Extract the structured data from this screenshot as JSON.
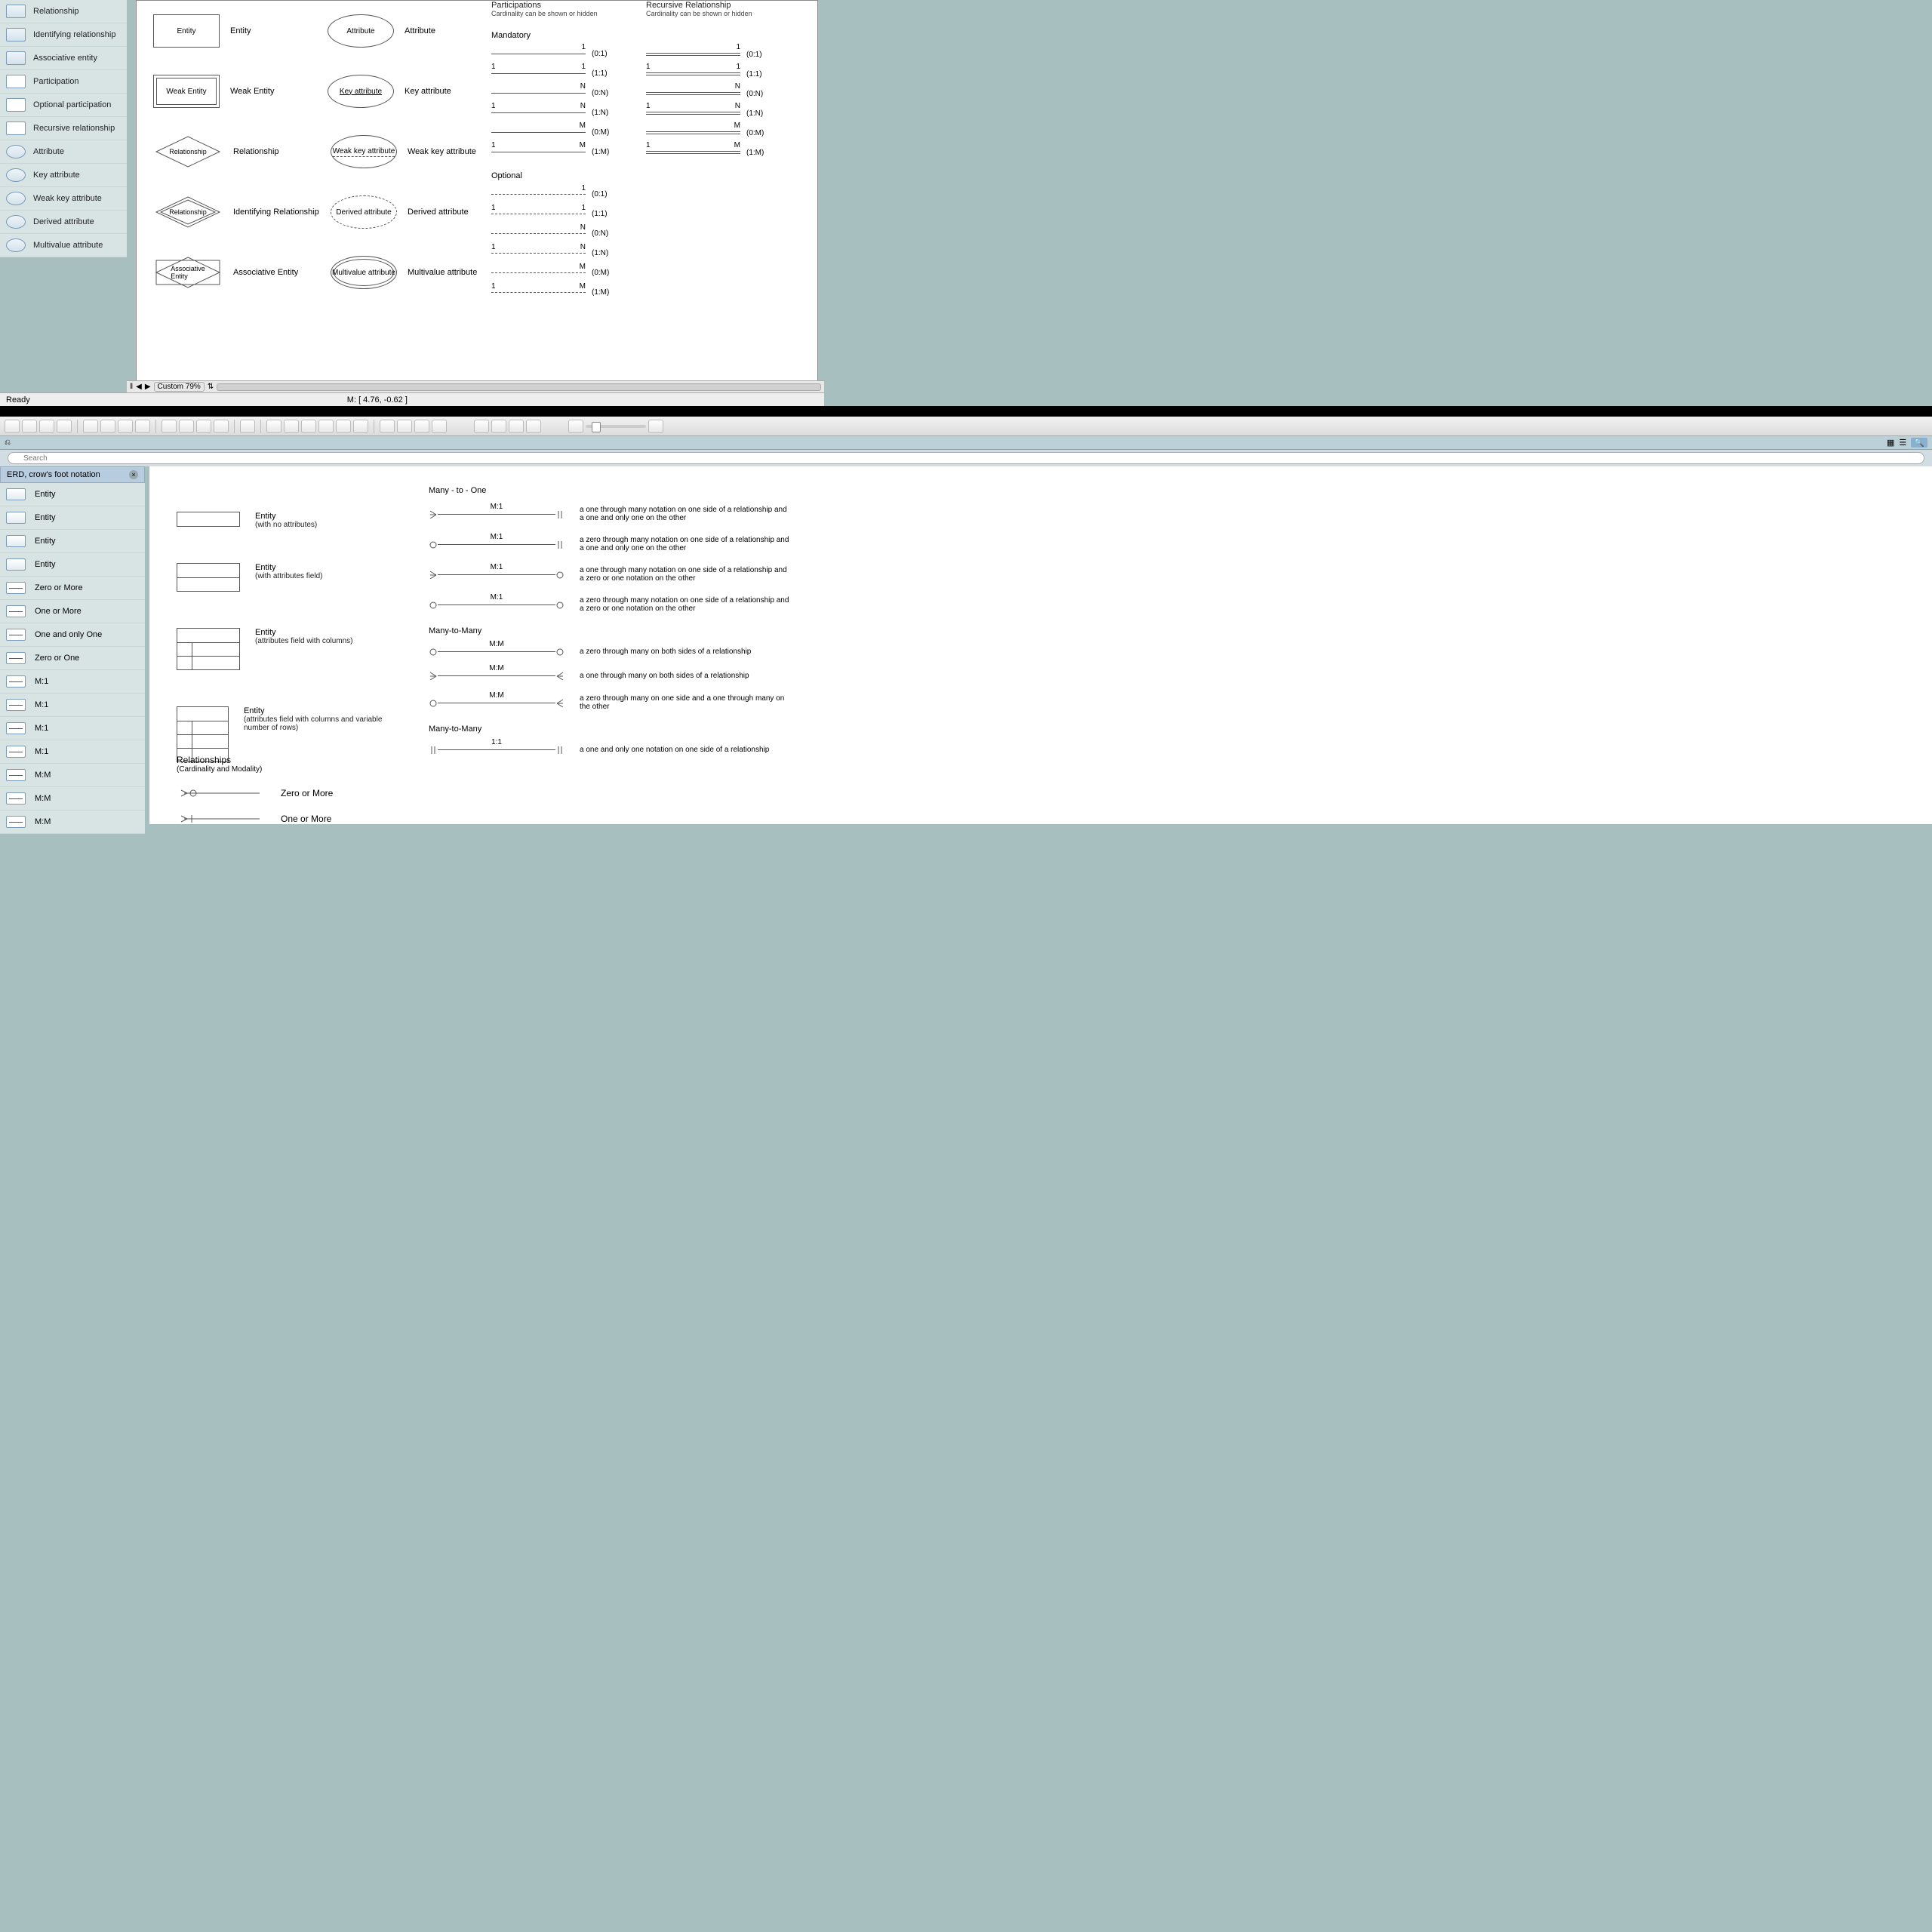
{
  "sidebar1": {
    "items": [
      {
        "label": "Relationship",
        "shape": "diamond"
      },
      {
        "label": "Identifying relationship",
        "shape": "diamond"
      },
      {
        "label": "Associative entity",
        "shape": "diamond"
      },
      {
        "label": "Participation",
        "shape": "rect"
      },
      {
        "label": "Optional participation",
        "shape": "rect"
      },
      {
        "label": "Recursive relationship",
        "shape": "rect"
      },
      {
        "label": "Attribute",
        "shape": "ellipse"
      },
      {
        "label": "Key attribute",
        "shape": "ellipse"
      },
      {
        "label": "Weak key attribute",
        "shape": "ellipse"
      },
      {
        "label": "Derived attribute",
        "shape": "ellipse"
      },
      {
        "label": "Multivalue attribute",
        "shape": "ellipse"
      }
    ]
  },
  "canvas1": {
    "shapes": [
      {
        "type": "rect",
        "variant": "single",
        "text": "Entity",
        "label": "Entity"
      },
      {
        "type": "rect",
        "variant": "double",
        "text": "Weak Entity",
        "label": "Weak Entity"
      },
      {
        "type": "diamond",
        "variant": "single",
        "text": "Relationship",
        "label": "Relationship"
      },
      {
        "type": "diamond",
        "variant": "double",
        "text": "Relationship",
        "label": "Identifying Relationship"
      },
      {
        "type": "diamond",
        "variant": "assoc",
        "text": "Associative Entity",
        "label": "Associative Entity"
      }
    ],
    "attrs": [
      {
        "variant": "plain",
        "text": "Attribute",
        "label": "Attribute"
      },
      {
        "variant": "underline",
        "text": "Key attribute",
        "label": "Key attribute"
      },
      {
        "variant": "dotted-under",
        "text": "Weak key attribute",
        "label": "Weak key attribute"
      },
      {
        "variant": "dashed",
        "text": "Derived attribute",
        "label": "Derived attribute"
      },
      {
        "variant": "double",
        "text": "Multivalue attribute",
        "label": "Multivalue attribute"
      }
    ],
    "participations_title": "Participations",
    "recursive_title": "Recursive Relationship",
    "card_sub": "Cardinality can be shown or hidden",
    "mandatory_label": "Mandatory",
    "optional_label": "Optional",
    "mandatory": [
      {
        "left": "",
        "right": "1",
        "ratio": "(0:1)"
      },
      {
        "left": "1",
        "right": "1",
        "ratio": "(1:1)"
      },
      {
        "left": "",
        "right": "N",
        "ratio": "(0:N)"
      },
      {
        "left": "1",
        "right": "N",
        "ratio": "(1:N)"
      },
      {
        "left": "",
        "right": "M",
        "ratio": "(0:M)"
      },
      {
        "left": "1",
        "right": "M",
        "ratio": "(1:M)"
      }
    ],
    "optional": [
      {
        "left": "",
        "right": "1",
        "ratio": "(0:1)"
      },
      {
        "left": "1",
        "right": "1",
        "ratio": "(1:1)"
      },
      {
        "left": "",
        "right": "N",
        "ratio": "(0:N)"
      },
      {
        "left": "1",
        "right": "N",
        "ratio": "(1:N)"
      },
      {
        "left": "",
        "right": "M",
        "ratio": "(0:M)"
      },
      {
        "left": "1",
        "right": "M",
        "ratio": "(1:M)"
      }
    ]
  },
  "footer": {
    "zoom": "Custom 79%",
    "ready": "Ready",
    "coords": "M: [ 4.76, -0.62 ]"
  },
  "search_placeholder": "Search",
  "library2": {
    "title": "ERD, crow's foot notation",
    "items": [
      {
        "label": "Entity",
        "kind": "rect"
      },
      {
        "label": "Entity",
        "kind": "rect"
      },
      {
        "label": "Entity",
        "kind": "rect"
      },
      {
        "label": "Entity",
        "kind": "rect"
      },
      {
        "label": "Zero or More",
        "kind": "conn"
      },
      {
        "label": "One or More",
        "kind": "conn"
      },
      {
        "label": "One and only One",
        "kind": "conn"
      },
      {
        "label": "Zero or One",
        "kind": "conn"
      },
      {
        "label": "M:1",
        "kind": "conn"
      },
      {
        "label": "M:1",
        "kind": "conn"
      },
      {
        "label": "M:1",
        "kind": "conn"
      },
      {
        "label": "M:1",
        "kind": "conn"
      },
      {
        "label": "M:M",
        "kind": "conn"
      },
      {
        "label": "M:M",
        "kind": "conn"
      },
      {
        "label": "M:M",
        "kind": "conn"
      }
    ]
  },
  "canvas2": {
    "entities": [
      {
        "title": "Entity",
        "sub": "(with no attributes)",
        "rows": 1
      },
      {
        "title": "Entity",
        "sub": "(with attributes field)",
        "rows": 2
      },
      {
        "title": "Entity",
        "sub": "(attributes field with columns)",
        "rows": 3
      },
      {
        "title": "Entity",
        "sub": "(attributes field with columns and variable number of rows)",
        "rows": 4
      }
    ],
    "rel_header": "Relationships",
    "rel_sub": "(Cardinality and Modality)",
    "zero_or_more": "Zero or More",
    "one_or_more": "One or More",
    "many_to_one_title": "Many - to - One",
    "many_to_many_title": "Many-to-Many",
    "many_to_many_title2": "Many-to-Many",
    "m1": [
      {
        "lbl": "M:1",
        "desc": "a one through many notation on one side of a relationship and a one and only one on the other"
      },
      {
        "lbl": "M:1",
        "desc": "a zero through many notation on one side of a relationship and a one and only one on the other"
      },
      {
        "lbl": "M:1",
        "desc": "a one through many notation on one side of a relationship and a zero or one notation on the other"
      },
      {
        "lbl": "M:1",
        "desc": "a zero through many notation on one side of a relationship and a zero or one notation on the other"
      }
    ],
    "mm": [
      {
        "lbl": "M:M",
        "desc": "a zero through many on both sides of a relationship"
      },
      {
        "lbl": "M:M",
        "desc": "a one through many on both sides of a relationship"
      },
      {
        "lbl": "M:M",
        "desc": "a zero through many on one side and a one through many on the other"
      }
    ],
    "oneone": [
      {
        "lbl": "1:1",
        "desc": "a one and only one notation on one side of a relationship"
      }
    ]
  }
}
